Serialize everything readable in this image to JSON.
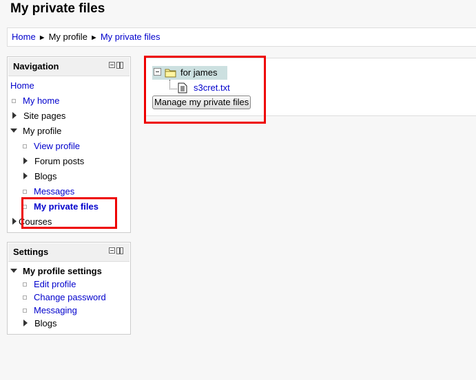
{
  "page": {
    "title": "My private files"
  },
  "breadcrumb": [
    {
      "label": "Home",
      "link": true
    },
    {
      "label": "My profile",
      "link": false
    },
    {
      "label": "My private files",
      "link": true
    }
  ],
  "breadcrumb_separator": "►",
  "navigation": {
    "title": "Navigation",
    "home": "Home",
    "my_home": "My home",
    "site_pages": "Site pages",
    "my_profile": "My profile",
    "view_profile": "View profile",
    "forum_posts": "Forum posts",
    "blogs": "Blogs",
    "messages": "Messages",
    "my_private_files": "My private files",
    "courses": "Courses"
  },
  "settings": {
    "title": "Settings",
    "my_profile_settings": "My profile settings",
    "edit_profile": "Edit profile",
    "change_password": "Change password",
    "messaging": "Messaging",
    "blogs": "Blogs"
  },
  "files": {
    "folder": "for james",
    "file": "s3cret.txt",
    "manage_button": "Manage my private files"
  },
  "colors": {
    "link": "#0000cc",
    "highlight": "#ee0000",
    "folder_row_bg": "#cce0e0"
  }
}
